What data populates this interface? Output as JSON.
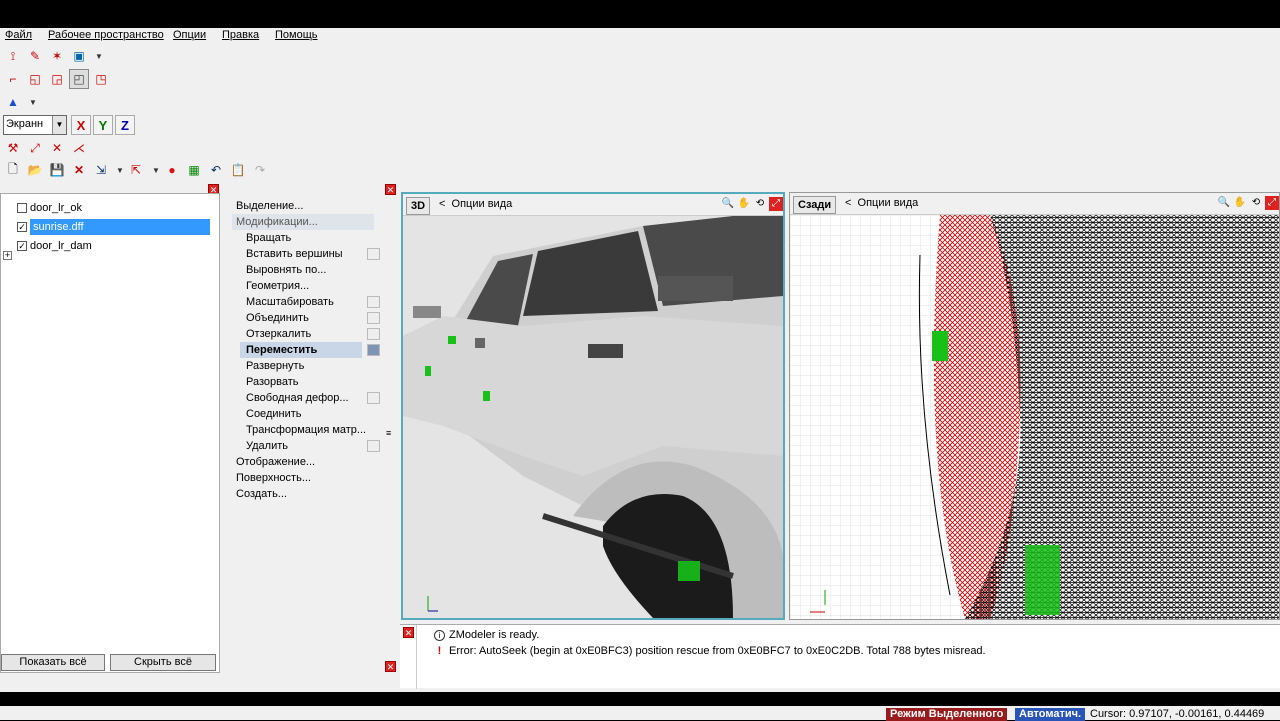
{
  "menu": [
    "Файл",
    "Рабочее пространство",
    "Опции",
    "Правка",
    "Помощь"
  ],
  "toolbar": {
    "coord_mode": "Экранн",
    "axes": [
      "X",
      "Y",
      "Z"
    ]
  },
  "tree": {
    "items": [
      {
        "label": "door_lr_ok",
        "checked": false
      },
      {
        "label": "sunrise.dff",
        "checked": true,
        "selected": true
      },
      {
        "label": "door_lr_dam",
        "checked": true
      }
    ],
    "show_all": "Показать всё",
    "hide_all": "Скрыть всё"
  },
  "commands": {
    "selection": "Выделение...",
    "modifications": "Модификации...",
    "sub": [
      "Вращать",
      "Вставить вершины",
      "Выровнять по...",
      "Геометрия...",
      "Масштабировать",
      "Объединить",
      "Отзеркалить",
      "Переместить",
      "Развернуть",
      "Разорвать",
      "Свободная дефор...",
      "Соединить",
      "Трансформация матр...",
      "Удалить"
    ],
    "display": "Отображение...",
    "surface": "Поверхность...",
    "create": "Создать..."
  },
  "viewports": [
    {
      "tag": "3D",
      "options": "Опции вида"
    },
    {
      "tag": "Сзади",
      "options": "Опции вида"
    }
  ],
  "log": [
    {
      "text": "ZModeler is ready."
    },
    {
      "text": "Error: AutoSeek (begin at 0xE0BFC3) position rescue  from 0xE0BFC7 to 0xE0C2DB. Total 788 bytes misread."
    }
  ],
  "status": {
    "mode": "Режим Выделенного",
    "auto": "Автоматич.",
    "cursor": "Cursor: 0.97107, -0.00161, 0.44469"
  },
  "colors": {
    "accent": "#3399ff",
    "error": "#cc0000",
    "mode_bg": "#9a1b1b",
    "auto_bg": "#2a55b8"
  }
}
